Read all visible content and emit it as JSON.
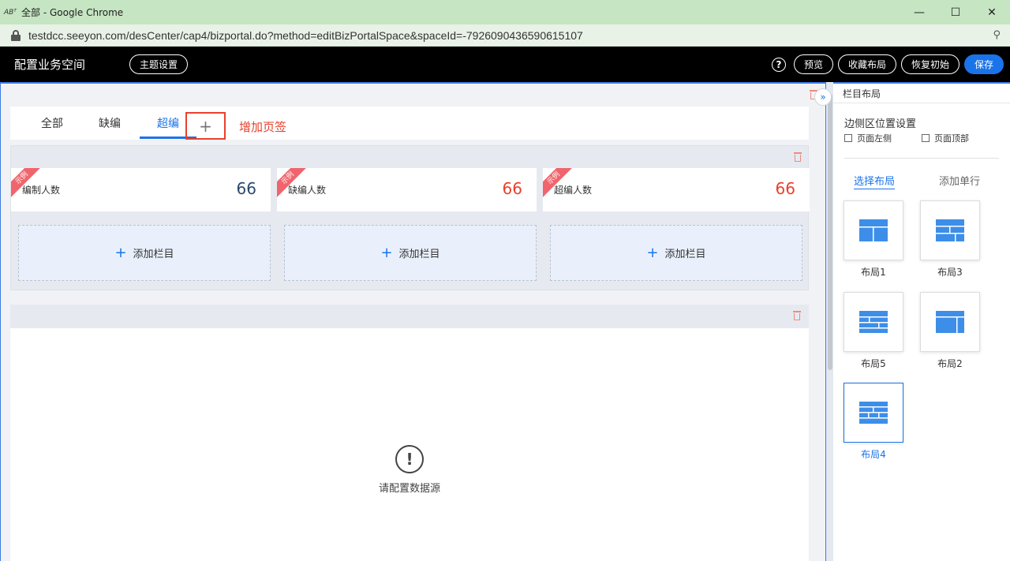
{
  "window": {
    "app_icon_text": "ABᵀ",
    "title": "全部 - Google Chrome",
    "minimize": "—",
    "maximize": "☐",
    "close": "✕"
  },
  "address": {
    "url": "testdcc.seeyon.com/desCenter/cap4/bizportal.do?method=editBizPortalSpace&spaceId=-7926090436590615107",
    "zoom_icon": "⚲"
  },
  "header": {
    "title": "配置业务空间",
    "theme_button": "主题设置",
    "help": "?",
    "preview_button": "预览",
    "collect_button": "收藏布局",
    "restore_button": "恢复初始",
    "save_button": "保存"
  },
  "tabs": {
    "items": [
      "全部",
      "缺编",
      "超编"
    ],
    "active_index": 2,
    "add_icon": "+",
    "callout": "增加页签"
  },
  "stats": [
    {
      "ribbon": "示例",
      "label": "编制人数",
      "value": "66",
      "color": "#2b4a6b"
    },
    {
      "ribbon": "示例",
      "label": "缺编人数",
      "value": "66",
      "color": "#e8412c"
    },
    {
      "ribbon": "示例",
      "label": "超编人数",
      "value": "66",
      "color": "#e8412c"
    }
  ],
  "add_column": {
    "plus": "+",
    "label": "添加栏目"
  },
  "empty_state": {
    "icon": "!",
    "text": "请配置数据源"
  },
  "panel": {
    "collapse_icon": "»",
    "title": "栏目布局",
    "side_position_label": "边侧区位置设置",
    "option_left": "页面左侧",
    "option_top": "页面顶部",
    "tab_select_layout": "选择布局",
    "tab_add_row": "添加单行",
    "layouts": [
      "布局1",
      "布局3",
      "布局5",
      "布局2",
      "布局4"
    ],
    "selected_layout": "布局4",
    "accent": "#1a73e8"
  }
}
